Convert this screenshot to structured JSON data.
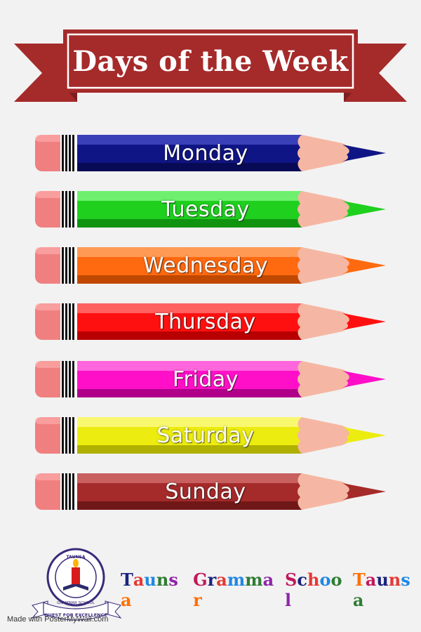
{
  "title": "Days of the Week",
  "colors": {
    "banner": "#a52a2a",
    "banner_dark": "#7d1f1f",
    "eraser": "#f08080",
    "wood": "#f5b7a3",
    "background": "#f2f2f2"
  },
  "days": [
    {
      "label": "Monday",
      "color": "#101585",
      "light": "#3a40b8",
      "dark": "#080a55"
    },
    {
      "label": "Tuesday",
      "color": "#1fd01f",
      "light": "#6ef06e",
      "dark": "#109410"
    },
    {
      "label": "Wednesday",
      "color": "#ff6a10",
      "light": "#ff9a55",
      "dark": "#c04800"
    },
    {
      "label": "Thursday",
      "color": "#ff1010",
      "light": "#ff6060",
      "dark": "#b80000"
    },
    {
      "label": "Friday",
      "color": "#ff10c8",
      "light": "#ff66dd",
      "dark": "#b0008a"
    },
    {
      "label": "Saturday",
      "color": "#ecec10",
      "light": "#f8f870",
      "dark": "#b0b000"
    },
    {
      "label": "Sunday",
      "color": "#a52a2a",
      "light": "#c86060",
      "dark": "#701818"
    }
  ],
  "logo": {
    "top_text": "TAUNSA",
    "ring_text": "GRAMMAR SCHOOL",
    "ribbon_text": "QUEST FOR EXCELLENCE",
    "icon": "candle-book-icon"
  },
  "school": {
    "words": [
      "Taunsa",
      "Grammar",
      "School",
      "Taunsa"
    ],
    "letter_colors": [
      "#1a237e",
      "#e53935",
      "#1e88e5",
      "#2e7d32",
      "#8e24aa",
      "#ff6f00",
      "#c2185b"
    ]
  },
  "credit": "Made with PosterMyWall.com"
}
